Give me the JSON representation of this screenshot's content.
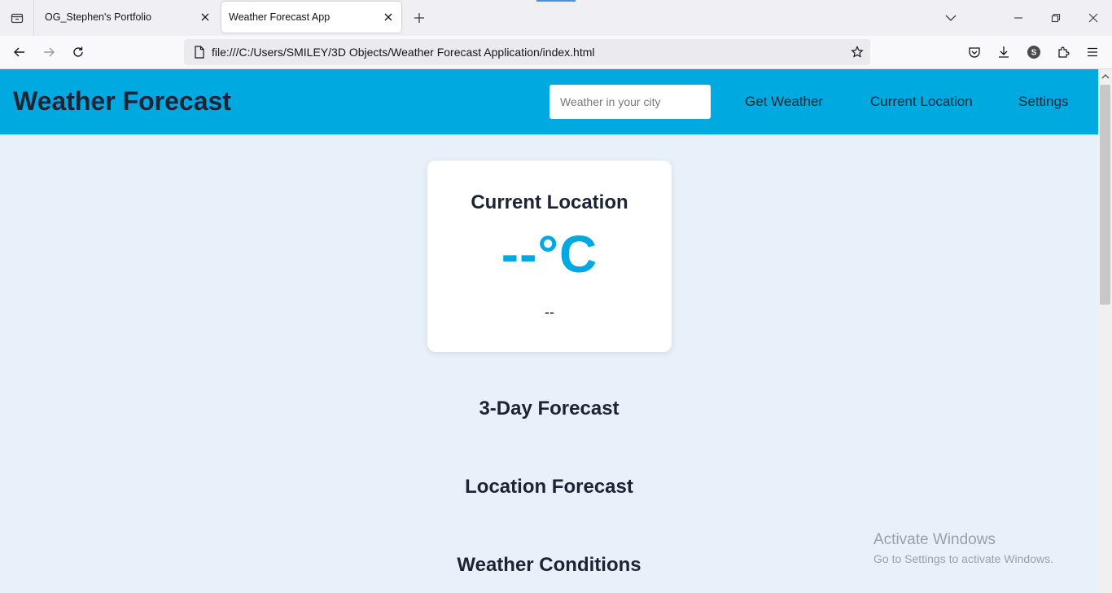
{
  "browser": {
    "tabs": [
      {
        "title": "OG_Stephen's Portfolio",
        "active": false
      },
      {
        "title": "Weather Forecast App",
        "active": true
      }
    ],
    "url": "file:///C:/Users/SMILEY/3D Objects/Weather Forecast Application/index.html",
    "profile_initial": "S"
  },
  "app": {
    "title": "Weather Forecast",
    "search": {
      "placeholder": "Weather in your city",
      "value": ""
    },
    "nav": {
      "get_weather": "Get Weather",
      "current_location": "Current Location",
      "settings": "Settings"
    },
    "card": {
      "title": "Current Location",
      "temperature": "--°C",
      "description": "--"
    },
    "sections": {
      "three_day": "3-Day Forecast",
      "location_forecast": "Location Forecast",
      "weather_conditions": "Weather Conditions"
    }
  },
  "watermark": {
    "title": "Activate Windows",
    "subtitle": "Go to Settings to activate Windows."
  },
  "colors": {
    "header_bg": "#00a9e0",
    "page_bg": "#e8f1fa",
    "accent_temp": "#00a9e0",
    "text_dark": "#1c2434"
  }
}
